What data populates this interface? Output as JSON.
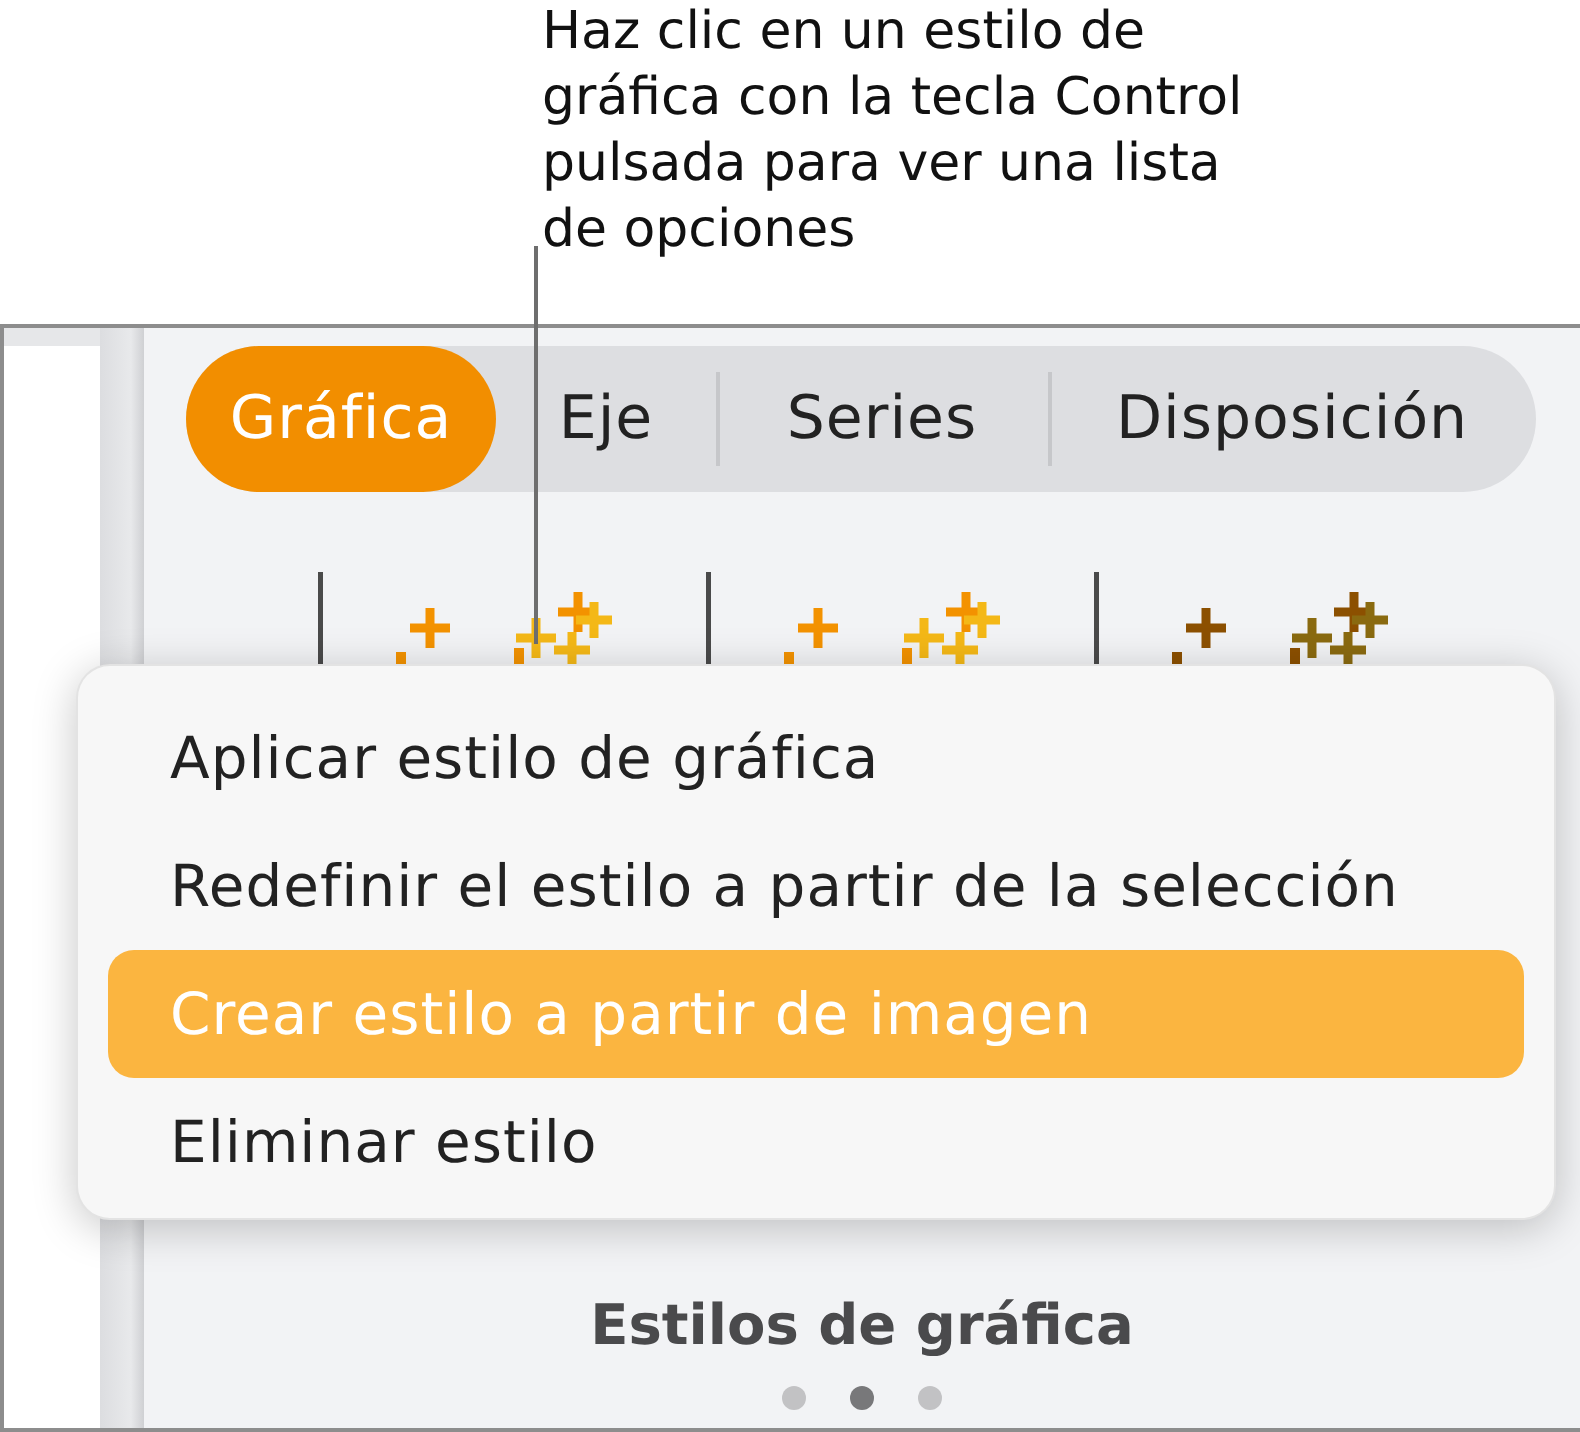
{
  "callout": {
    "text": "Haz clic en un estilo de gráfica con la tecla Control pulsada para ver una lista de opciones"
  },
  "tabs": [
    {
      "label": "Gráfica",
      "selected": true
    },
    {
      "label": "Eje",
      "selected": false
    },
    {
      "label": "Series",
      "selected": false
    },
    {
      "label": "Disposición",
      "selected": false
    }
  ],
  "context_menu": {
    "items": [
      {
        "label": "Aplicar estilo de gráfica",
        "selected": false
      },
      {
        "label": "Redefinir el estilo a partir de la selección",
        "selected": false
      },
      {
        "label": "Crear estilo a partir de imagen",
        "selected": true
      },
      {
        "label": "Eliminar estilo",
        "selected": false
      }
    ]
  },
  "section_title": "Estilos de gráfica",
  "page_dots": [
    {
      "selected": false
    },
    {
      "selected": true
    },
    {
      "selected": false
    }
  ]
}
